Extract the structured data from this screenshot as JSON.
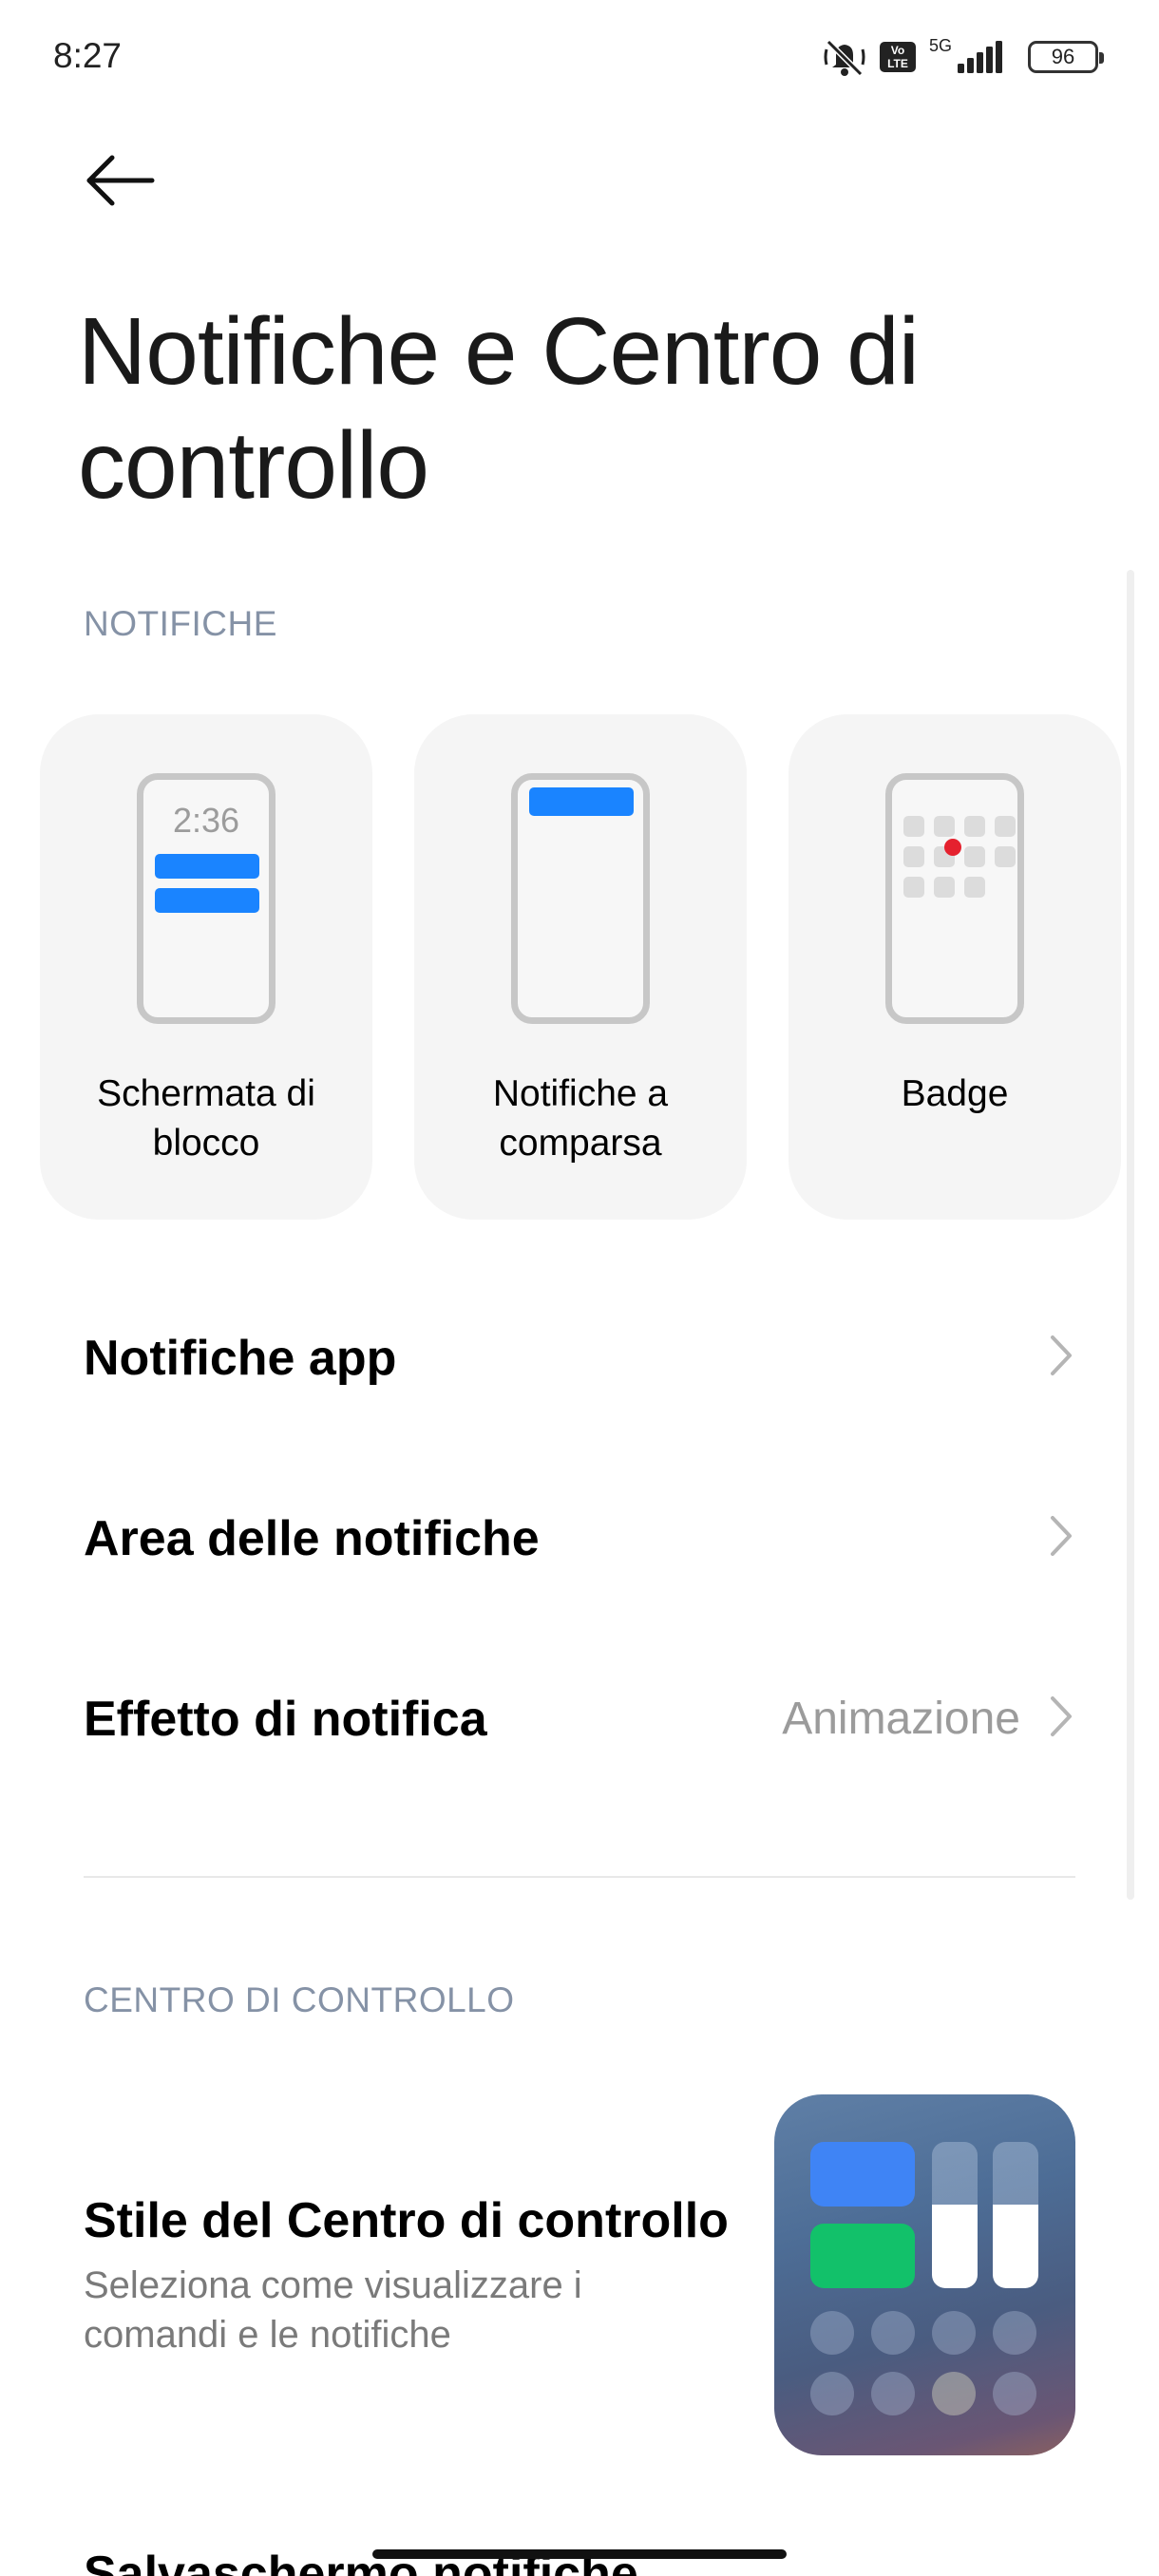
{
  "status_bar": {
    "time": "8:27",
    "network": "5G",
    "volte": "Vo LTE",
    "battery": "96"
  },
  "header": {
    "title": "Notifiche e Centro di controllo"
  },
  "notifications_section": {
    "label": "NOTIFICHE",
    "cards": [
      {
        "label": "Schermata di blocco",
        "preview_time": "2:36"
      },
      {
        "label": "Notifiche a comparsa"
      },
      {
        "label": "Badge"
      }
    ],
    "rows": [
      {
        "label": "Notifiche app",
        "value": ""
      },
      {
        "label": "Area delle notifiche",
        "value": ""
      },
      {
        "label": "Effetto di notifica",
        "value": "Animazione"
      }
    ]
  },
  "control_center_section": {
    "label": "CENTRO DI CONTROLLO",
    "style_row": {
      "title": "Stile del Centro di controllo",
      "description": "Seleziona come visualizzare i comandi e le notifiche"
    },
    "next_row_partial": "Salvaschermo notifiche"
  },
  "colors": {
    "accent": "#1a84ff",
    "section_header": "#8592a6",
    "badge_dot": "#e5212e"
  }
}
